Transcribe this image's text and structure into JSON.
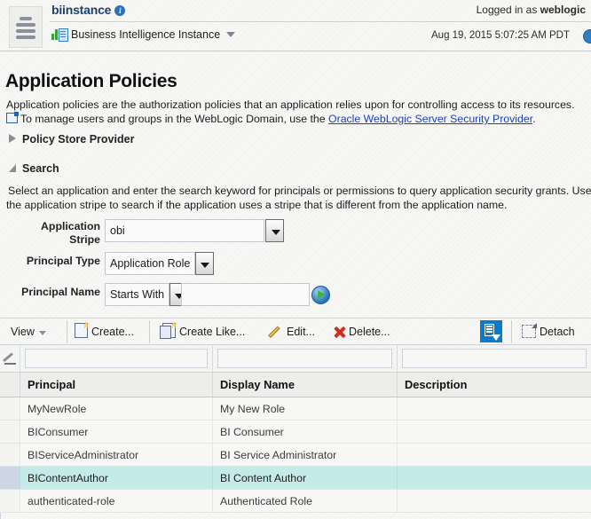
{
  "header": {
    "menu_icon": "hamburger-menu-icon",
    "instance_name": "biinstance",
    "info_icon": "info-icon",
    "breadcrumb_label": "Business Intelligence Instance",
    "breadcrumb_icon": "bi-instance-icon",
    "logged_in_prefix": "Logged in as ",
    "logged_in_user": "weblogic",
    "timestamp": "Aug 19, 2015 5:07:25 AM PDT",
    "help_icon": "help-icon"
  },
  "page": {
    "title": "Application Policies",
    "description_line1": "Application policies are the authorization policies that an application relies upon for controlling access to its resources.",
    "description_line2_pre": "To manage users and groups in the WebLogic Domain, use the ",
    "description_link": "Oracle WebLogic Server Security Provider",
    "description_line2_post": ".",
    "launch_icon": "external-launch-icon"
  },
  "sections": {
    "policy_store_provider": "Policy Store Provider",
    "search": "Search",
    "search_help_line1": "Select an application and enter the search keyword for principals or permissions to query application security grants. Use",
    "search_help_line2": "the application stripe to search if the application uses a stripe that is different from the application name."
  },
  "form": {
    "application_stripe_label": "Application Stripe",
    "application_stripe_value": "obi",
    "principal_type_label": "Principal Type",
    "principal_type_value": "Application Role",
    "principal_name_label": "Principal Name",
    "principal_name_operator": "Starts With",
    "principal_name_value": "",
    "principal_name_placeholder": "",
    "search_go_icon": "search-go-icon"
  },
  "toolbar": {
    "view_label": "View",
    "create_label": "Create...",
    "create_like_label": "Create Like...",
    "edit_label": "Edit...",
    "delete_label": "Delete...",
    "query_by_example_icon": "query-by-example-icon",
    "detach_label": "Detach",
    "detach_icon": "detach-icon"
  },
  "table": {
    "filter_icon": "row-edit-indicator-icon",
    "filters": [
      "",
      "",
      ""
    ],
    "columns": [
      "Principal",
      "Display Name",
      "Description"
    ],
    "rows": [
      {
        "principal": "MyNewRole",
        "display_name": "My New Role",
        "description": "",
        "selected": false
      },
      {
        "principal": "BIConsumer",
        "display_name": "BI Consumer",
        "description": "",
        "selected": false
      },
      {
        "principal": "BIServiceAdministrator",
        "display_name": "BI Service Administrator",
        "description": "",
        "selected": false
      },
      {
        "principal": "BIContentAuthor",
        "display_name": "BI Content Author",
        "description": "",
        "selected": true
      },
      {
        "principal": "authenticated-role",
        "display_name": "Authenticated Role",
        "description": "",
        "selected": false
      }
    ]
  },
  "colors": {
    "accent_blue": "#0a7ac9",
    "link_blue": "#1a3fbd",
    "selected_row": "#c5ebe9",
    "title_blue": "#1c3f6e"
  }
}
